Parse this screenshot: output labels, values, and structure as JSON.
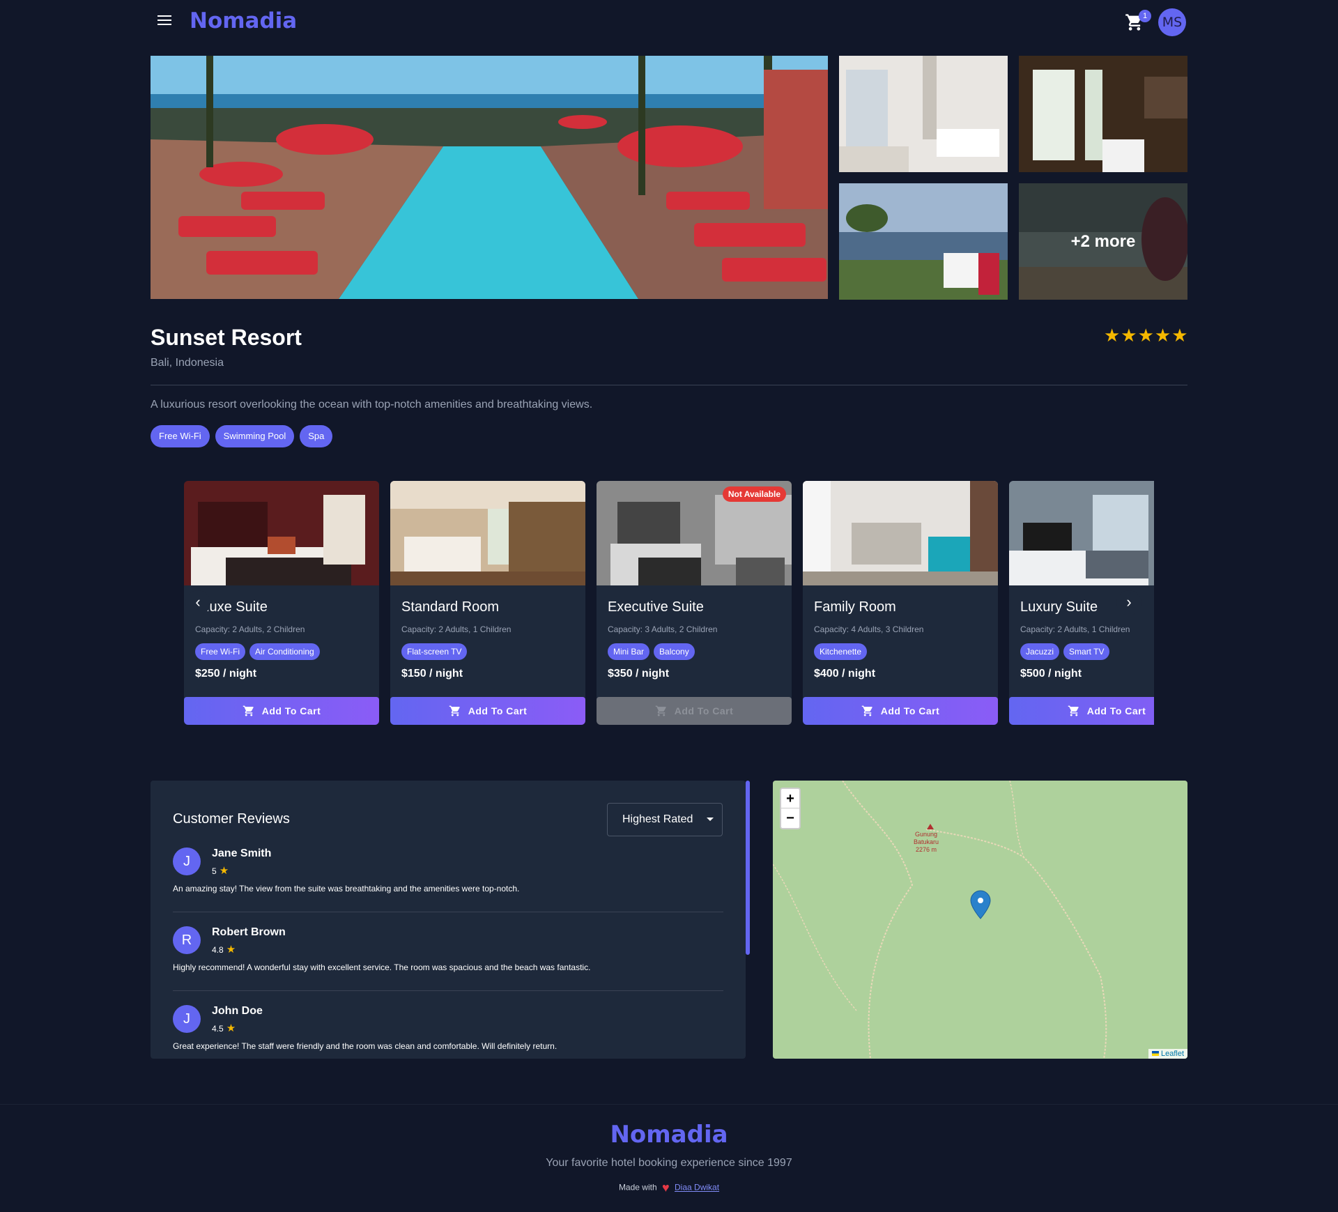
{
  "header": {
    "brand": "Nomadia",
    "cart_count": "1",
    "avatar_initials": "MS"
  },
  "gallery": {
    "more_label": "+2 more"
  },
  "hotel": {
    "name": "Sunset Resort",
    "location": "Bali, Indonesia",
    "rating_stars": "★★★★★",
    "description": "A luxurious resort overlooking the ocean with top-notch amenities and breathtaking views.",
    "amenities": [
      "Free Wi-Fi",
      "Swimming Pool",
      "Spa"
    ]
  },
  "rooms": [
    {
      "name": "luxe Suite",
      "capacity": "Capacity: 2 Adults, 2 Children",
      "amenities": [
        "Free Wi-Fi",
        "Air Conditioning"
      ],
      "price": "$250 / night",
      "button": "Add To Cart",
      "available": true
    },
    {
      "name": "Standard Room",
      "capacity": "Capacity: 2 Adults, 1 Children",
      "amenities": [
        "Flat-screen TV"
      ],
      "price": "$150 / night",
      "button": "Add To Cart",
      "available": true
    },
    {
      "name": "Executive Suite",
      "capacity": "Capacity: 3 Adults, 2 Children",
      "amenities": [
        "Mini Bar",
        "Balcony"
      ],
      "price": "$350 / night",
      "button": "Add To Cart",
      "available": false,
      "badge": "Not Available"
    },
    {
      "name": "Family Room",
      "capacity": "Capacity: 4 Adults, 3 Children",
      "amenities": [
        "Kitchenette"
      ],
      "price": "$400 / night",
      "button": "Add To Cart",
      "available": true
    },
    {
      "name": "Luxury Suite",
      "capacity": "Capacity: 2 Adults, 1 Children",
      "amenities": [
        "Jacuzzi",
        "Smart TV"
      ],
      "price": "$500 / night",
      "button": "Add To Cart",
      "available": true
    }
  ],
  "carousel": {
    "prev": "‹",
    "next": "›"
  },
  "reviews": {
    "title": "Customer Reviews",
    "sort_value": "Highest Rated",
    "items": [
      {
        "initial": "J",
        "name": "Jane Smith",
        "rating": "5",
        "text": "An amazing stay! The view from the suite was breathtaking and the amenities were top-notch."
      },
      {
        "initial": "R",
        "name": "Robert Brown",
        "rating": "4.8",
        "text": "Highly recommend! A wonderful stay with excellent service. The room was spacious and the beach was fantastic."
      },
      {
        "initial": "J",
        "name": "John Doe",
        "rating": "4.5",
        "text": "Great experience! The staff were friendly and the room was clean and comfortable. Will definitely return."
      }
    ]
  },
  "map": {
    "zoom_in": "+",
    "zoom_out": "−",
    "peak_name": "Gunung Batukaru",
    "peak_elevation": "2276 m",
    "attribution": "Leaflet"
  },
  "footer": {
    "brand": "Nomadia",
    "tagline": "Your favorite hotel booking experience since 1997",
    "made_with": "Made with",
    "author": "Diaa Dwikat"
  },
  "colors": {
    "background": "#111729",
    "card": "#1e293b",
    "accent": "#6366f1",
    "star": "#f5b800",
    "danger": "#e53935"
  }
}
